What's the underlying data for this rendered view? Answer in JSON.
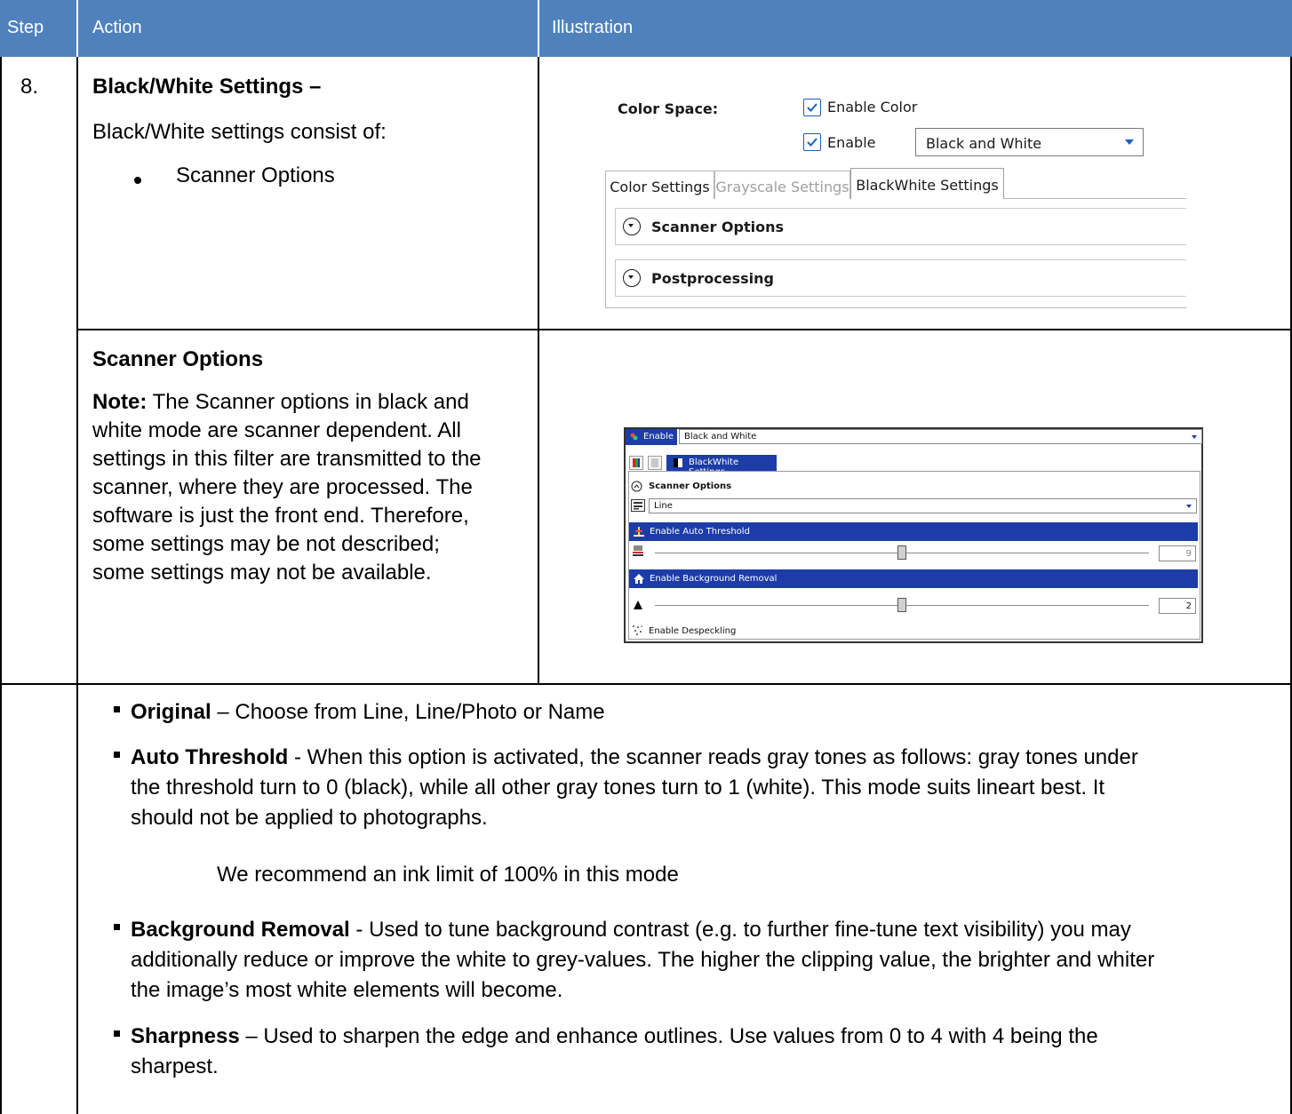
{
  "header": {
    "step": "Step",
    "action": "Action",
    "illustration": "Illustration"
  },
  "row1": {
    "step_number": "8.",
    "heading": "Black/White Settings –",
    "intro": "Black/White settings consist of:",
    "bullet": "Scanner Options"
  },
  "illustration1": {
    "color_space_label": "Color Space:",
    "enable_color_label": "Enable Color",
    "enable_color_checked": true,
    "enable_label": "Enable",
    "enable_checked": true,
    "mode_value": "Black and White",
    "tabs": [
      "Color Settings",
      "Grayscale Settings",
      "BlackWhite Settings"
    ],
    "active_tab": "BlackWhite Settings",
    "expanders": [
      "Scanner Options",
      "Postprocessing"
    ]
  },
  "row2": {
    "heading": "Scanner Options",
    "note_label": "Note:",
    "note_lines": [
      " The Scanner options in black and",
      "white mode are scanner dependent. All",
      "settings in this filter are transmitted to the",
      "scanner, where they are processed. The",
      "software is just the front end. Therefore,",
      "some settings may be not described;",
      "some settings may not be available."
    ]
  },
  "illustration2": {
    "enable_label": "Enable",
    "mode_value": "Black and White",
    "active_tab": "BlackWhite Settings",
    "section_title": "Scanner Options",
    "original_value": "Line",
    "auto_threshold_label": "Enable Auto Threshold",
    "threshold_value": "9",
    "threshold_level": 0.5,
    "background_removal_label": "Enable Background Removal",
    "background_value": "2",
    "background_level": 0.5,
    "despeckling_label": "Enable Despeckling"
  },
  "details": [
    {
      "term": "Original",
      "text": " – Choose from Line, Line/Photo or Name"
    },
    {
      "term": "Auto Threshold",
      "lines": [
        " - When this option is activated, the scanner reads gray tones as follows: gray tones under",
        "the threshold turn to 0 (black), while all other gray tones turn to 1 (white). This mode suits lineart best. It",
        "should not be applied to photographs."
      ]
    },
    {
      "recommendation": "We recommend an ink limit of 100% in this mode"
    },
    {
      "term": "Background Removal",
      "lines": [
        " - Used to tune background contrast (e.g. to further fine-tune text visibility) you may",
        "additionally reduce or improve the white to grey-values. The higher the clipping value, the brighter and whiter",
        "the image’s most white elements will become."
      ]
    },
    {
      "term": "Sharpness",
      "lines": [
        " – Used to sharpen the edge and enhance outlines. Use values from 0 to 4 with 4 being the",
        "sharpest."
      ]
    }
  ],
  "colors": {
    "header_bg": "#4f81bd",
    "ui_accent": "#1c3ca8",
    "checkbox_accent": "#1a5fb4"
  }
}
